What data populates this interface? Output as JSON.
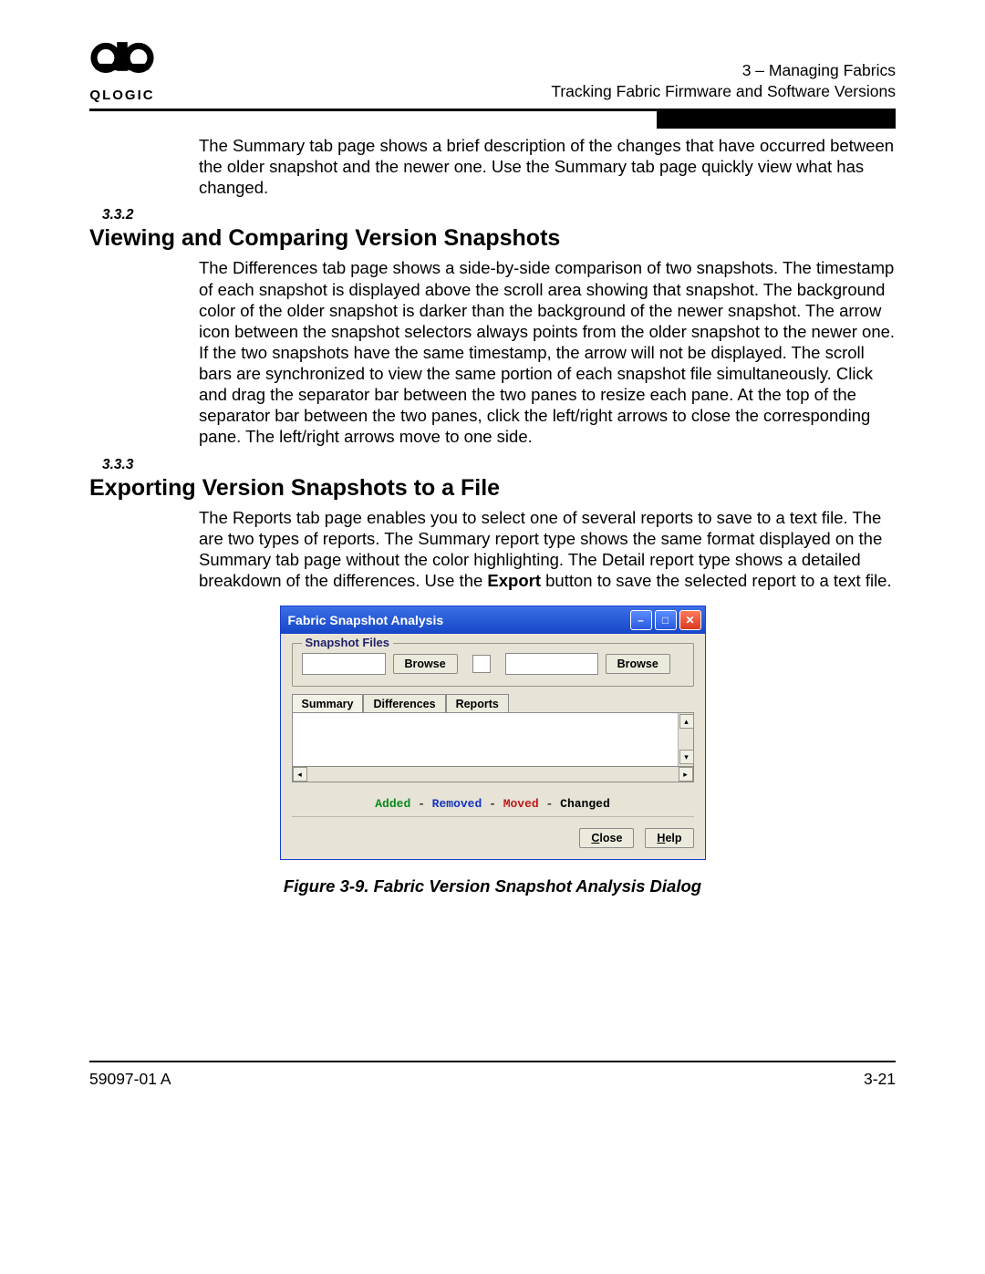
{
  "header": {
    "brand": "QLOGIC",
    "line1": "3 – Managing Fabrics",
    "line2": "Tracking Fabric Firmware and Software Versions"
  },
  "intro_para": "The Summary tab page shows a brief description of the changes that have occurred between the older snapshot and the newer one. Use the Summary tab page quickly view what has changed.",
  "sections": [
    {
      "num": "3.3.2",
      "title": "Viewing and Comparing Version Snapshots",
      "para": "The Differences tab page shows a side-by-side comparison of two snapshots. The timestamp of each snapshot is displayed above the scroll area showing that snapshot. The background color of the older snapshot is darker than the background of the newer snapshot. The arrow icon between the snapshot selectors always points from the older snapshot to the newer one. If the two snapshots have the same timestamp, the arrow will not be displayed. The scroll bars are synchronized to view the same portion of each snapshot file simultaneously. Click and drag the separator bar between the two panes to resize each pane. At the top of the separator bar between the two panes, click the left/right arrows to close the corresponding pane. The left/right arrows move to one side."
    },
    {
      "num": "3.3.3",
      "title": "Exporting Version Snapshots to a File",
      "para_pre": "The Reports tab page enables you to select one of several reports to save to a text file. The are two types of reports. The Summary report type shows the same format displayed on the Summary tab page without the color highlighting. The Detail report type shows a detailed breakdown of the differences. Use the ",
      "para_bold": "Export",
      "para_post": " button to save the selected report to a text file."
    }
  ],
  "dialog": {
    "title": "Fabric Snapshot Analysis",
    "group_label": "Snapshot Files",
    "browse": "Browse",
    "tabs": [
      "Summary",
      "Differences",
      "Reports"
    ],
    "legend": {
      "added": "Added",
      "removed": "Removed",
      "moved": "Moved",
      "changed": "Changed"
    },
    "close_letter": "C",
    "close_rest": "lose",
    "help_letter": "H",
    "help_rest": "elp"
  },
  "caption": "Figure 3-9.  Fabric Version Snapshot Analysis Dialog",
  "footer": {
    "left": "59097-01 A",
    "right": "3-21"
  }
}
